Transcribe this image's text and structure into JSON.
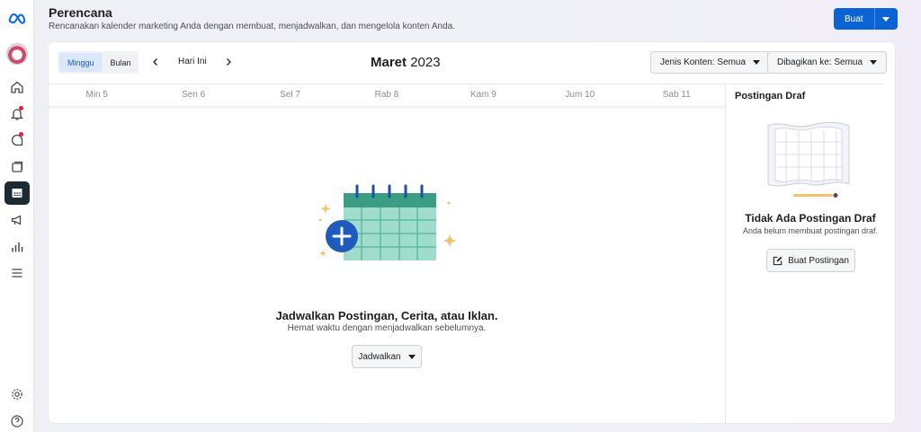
{
  "header": {
    "title": "Perencana",
    "subtitle": "Rencanakan kalender marketing Anda dengan membuat, menjadwalkan, dan mengelola konten Anda.",
    "create_label": "Buat"
  },
  "rail": {
    "icons": [
      "meta-logo-icon",
      "avatar",
      "home-icon",
      "notifications-icon",
      "messages-icon",
      "content-icon",
      "planner-icon",
      "ads-icon",
      "insights-icon",
      "menu-icon",
      "settings-icon",
      "help-icon"
    ]
  },
  "toolbar": {
    "week_label": "Minggu",
    "month_label": "Bulan",
    "today_label": "Hari Ini",
    "month_name": "Maret",
    "year": "2023",
    "content_filter": "Jenis Konten: Semua",
    "share_filter": "Dibagikan ke: Semua"
  },
  "days": [
    "Min 5",
    "Sen 6",
    "Sel 7",
    "Rab 8",
    "Kam 9",
    "Jum 10",
    "Sab 11"
  ],
  "empty_state": {
    "title": "Jadwalkan Postingan, Cerita, atau Iklan.",
    "subtitle": "Hemat waktu dengan menjadwalkan sebelumnya.",
    "schedule_label": "Jadwalkan"
  },
  "drafts": {
    "heading": "Postingan Draf",
    "empty_title": "Tidak Ada Postingan Draf",
    "empty_subtitle": "Anda belum membuat postingan draf.",
    "create_label": "Buat Postingan"
  },
  "colors": {
    "primary": "#0c63d4",
    "calendar_green": "#3a9d84",
    "calendar_light": "#9fdccb",
    "notification": "#e41e3f"
  }
}
